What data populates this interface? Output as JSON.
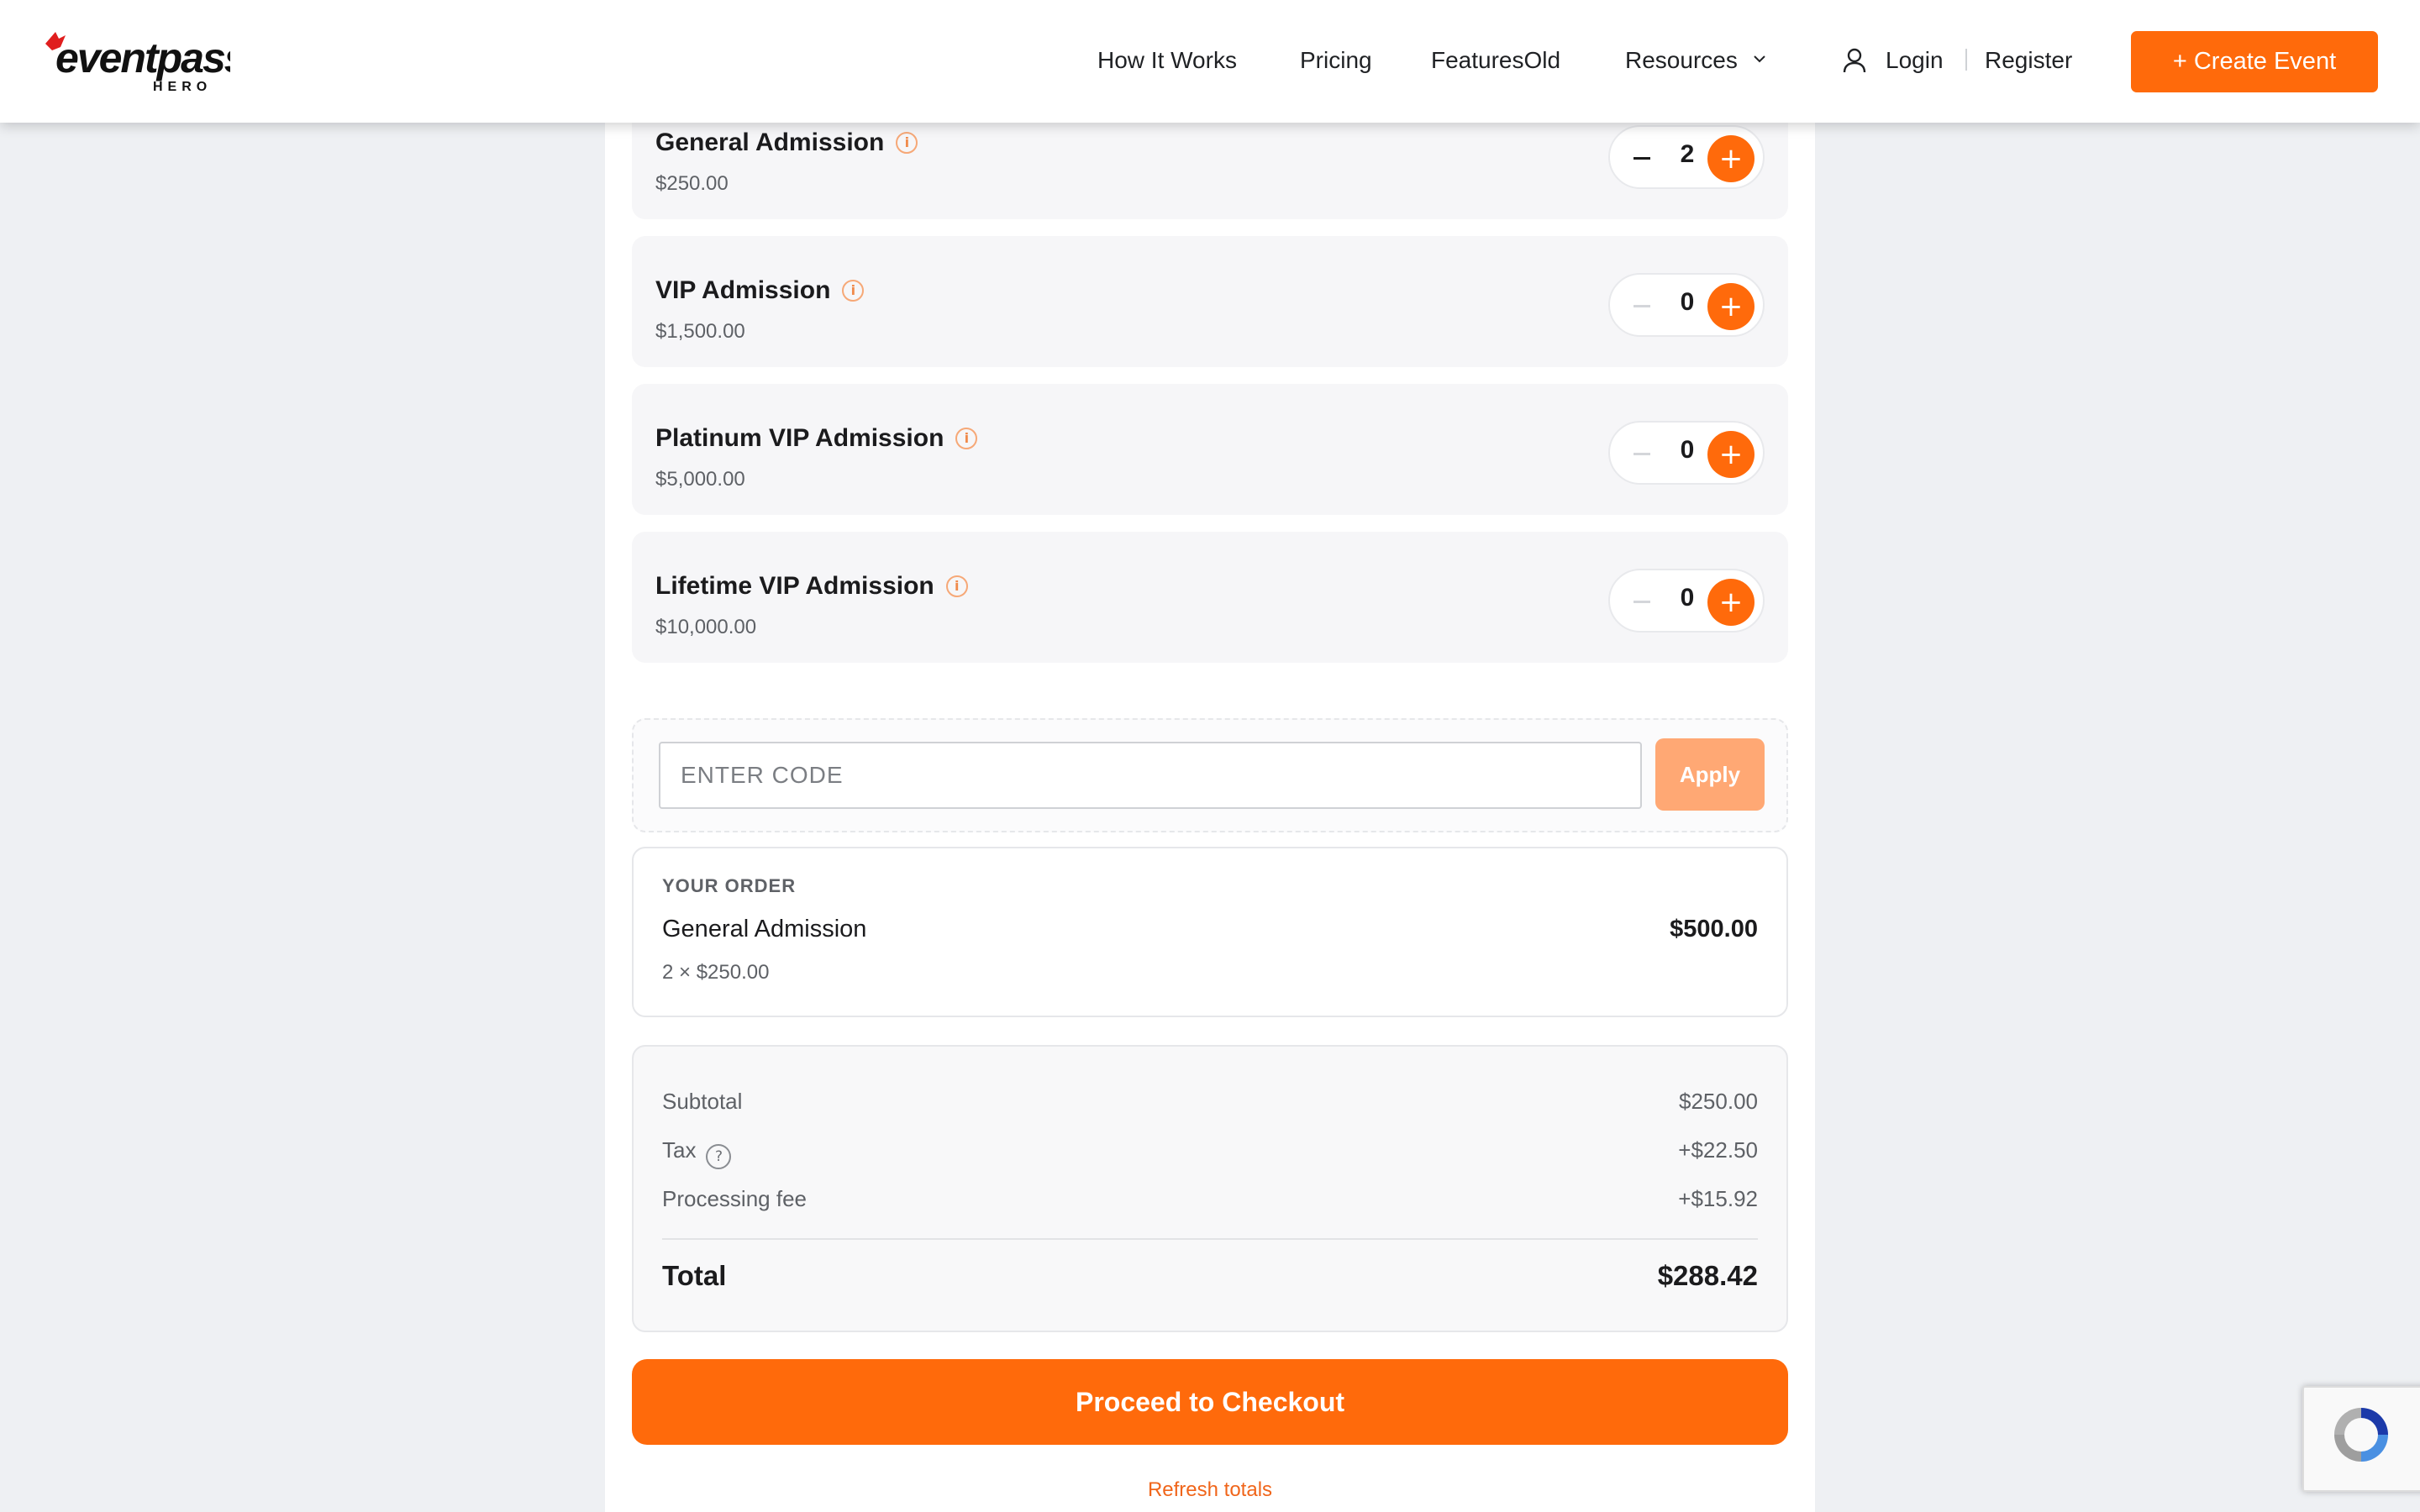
{
  "header": {
    "logo_text": "eventpass",
    "logo_subtext": "HERO",
    "nav": [
      "How It Works",
      "Pricing",
      "FeaturesOld",
      "Resources"
    ],
    "login_label": "Login",
    "register_label": "Register",
    "create_event_label": "+ Create Event"
  },
  "tickets": [
    {
      "name": "General Admission",
      "price": "$250.00",
      "quantity": "2"
    },
    {
      "name": "VIP Admission",
      "price": "$1,500.00",
      "quantity": "0"
    },
    {
      "name": "Platinum VIP Admission",
      "price": "$5,000.00",
      "quantity": "0"
    },
    {
      "name": "Lifetime VIP Admission",
      "price": "$10,000.00",
      "quantity": "0"
    }
  ],
  "promo": {
    "placeholder": "ENTER CODE",
    "apply_label": "Apply"
  },
  "order": {
    "heading": "YOUR ORDER",
    "item_name": "General Admission",
    "item_amount": "$500.00",
    "item_detail": "2 × $250.00"
  },
  "totals": {
    "subtotal_label": "Subtotal",
    "subtotal_value": "$250.00",
    "tax_label": "Tax",
    "tax_value": "+$22.50",
    "fee_label": "Processing fee",
    "fee_value": "+$15.92",
    "total_label": "Total",
    "total_value": "$288.42"
  },
  "checkout_label": "Proceed to Checkout",
  "refresh_label": "Refresh totals",
  "colors": {
    "accent": "#ff6a0b",
    "accent_light": "#ffa874",
    "background": "#eef0f3"
  }
}
